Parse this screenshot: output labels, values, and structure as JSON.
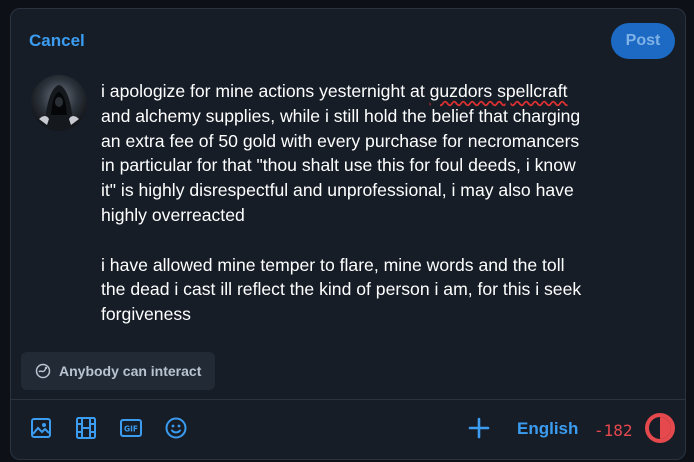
{
  "header": {
    "cancel_label": "Cancel",
    "post_label": "Post"
  },
  "composer": {
    "avatar_icon": "hooded-figure-avatar",
    "paragraph1_before": "i apologize for mine actions yesternight at ",
    "misspelled_word": "guzdors spellcraft",
    "paragraph1_after": "\nand alchemy supplies, while i still hold the belief that charging\nan extra fee of 50 gold with every purchase for necromancers\nin particular for that \"thou shalt use this for foul deeds, i know\nit\" is highly disrespectful and unprofessional, i may also have\nhighly overreacted",
    "paragraph2": "\n\ni have allowed mine temper to flare, mine words and the toll\nthe dead i cast ill reflect the kind of person i am, for this i seek\nforgiveness"
  },
  "audience": {
    "label": "Anybody can interact",
    "icon": "globe-interact-icon"
  },
  "toolbar": {
    "icons": [
      "image-icon",
      "video-icon",
      "gif-icon",
      "emoji-icon"
    ],
    "gif_text": "GIF",
    "add_icon": "plus-icon",
    "language": "English",
    "char_count": "-182",
    "char_limit_ring_fill": 1.0
  },
  "colors": {
    "accent": "#3b9cf0",
    "post_bg": "#1d6ac4",
    "over_limit": "#e5484d",
    "panel_bg": "#161d27"
  }
}
